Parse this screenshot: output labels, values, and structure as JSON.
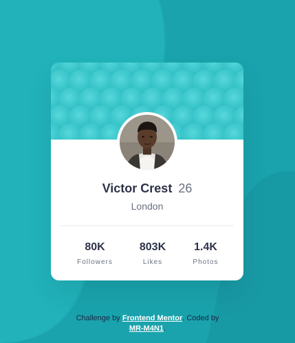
{
  "theme": {
    "background": "#1aa3ad",
    "card_background": "#ffffff",
    "pattern_color": "#36c6cc",
    "text_dark": "#2e3349",
    "text_muted": "#6b7082"
  },
  "profile": {
    "name": "Victor Crest",
    "age": "26",
    "location": "London",
    "avatar_icon": "profile-photo"
  },
  "stats": [
    {
      "value": "80K",
      "label": "Followers"
    },
    {
      "value": "803K",
      "label": "Likes"
    },
    {
      "value": "1.4K",
      "label": "Photos"
    }
  ],
  "attribution": {
    "prefix": "Challenge by",
    "link1": "Frontend Mentor",
    "middle": ". Coded by",
    "link2": "MR-M4N1",
    "suffix": "."
  }
}
